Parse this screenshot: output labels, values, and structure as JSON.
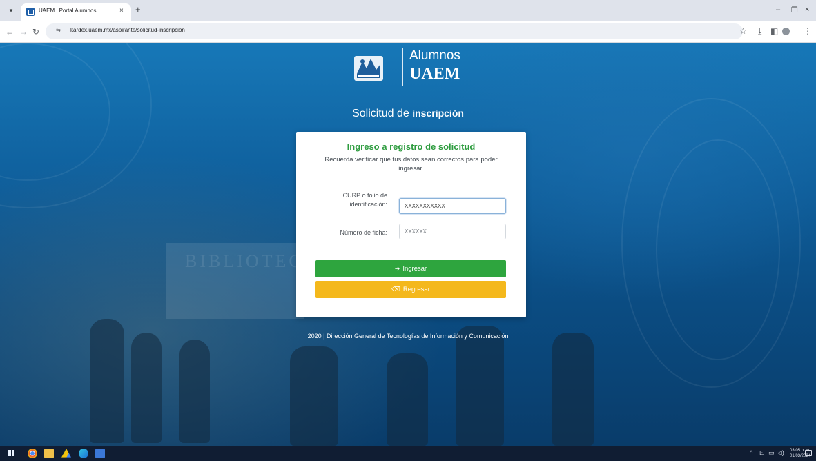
{
  "browser": {
    "tab_title": "UAEM | Portal Alumnos",
    "tab_close": "×",
    "new_tab": "+",
    "url": "kardex.uaem.mx/aspirante/solicitud-inscripcion",
    "icons": [
      "tab-search-icon",
      "favicon-icon",
      "close-icon",
      "plus-icon",
      "back-icon",
      "forward-icon",
      "reload-icon",
      "site-info-icon",
      "star-icon",
      "download-icon",
      "side-panel-icon",
      "profile-icon",
      "kebab-menu-icon"
    ]
  },
  "window_controls": {
    "minimize": "–",
    "maximize": "❐",
    "close": "×"
  },
  "header": {
    "logo_sub": "Alumnos",
    "logo_main": "UAEM"
  },
  "page": {
    "title_part1": "Solicitud de ",
    "title_part2": "inscripción"
  },
  "form": {
    "title": "Ingreso a registro de solicitud",
    "description": "Recuerda verificar que tus datos sean correctos para poder ingresar.",
    "curp_label": "CURP o folio de identificación:",
    "curp_value": "XXXXXXXXXXX",
    "ficha_label": "Número de ficha:",
    "ficha_placeholder": "XXXXXX",
    "submit_label": "Ingresar",
    "back_label": "Regresar"
  },
  "footer": {
    "text": "2020 | Dirección General de Tecnologías de Información y Comunicación"
  },
  "taskbar": {
    "clock_time": "03:05 p. m.",
    "clock_date": "01/03/2024",
    "apps": [
      "windows-start-icon",
      "chrome-icon",
      "file-explorer-icon",
      "google-drive-icon",
      "edge-icon",
      "app-icon"
    ]
  },
  "colors": {
    "primary_green": "#2ea53e",
    "warning_yellow": "#f4b81c",
    "title_green": "#2e9c3f",
    "background_blue": "#0f5f9c"
  }
}
